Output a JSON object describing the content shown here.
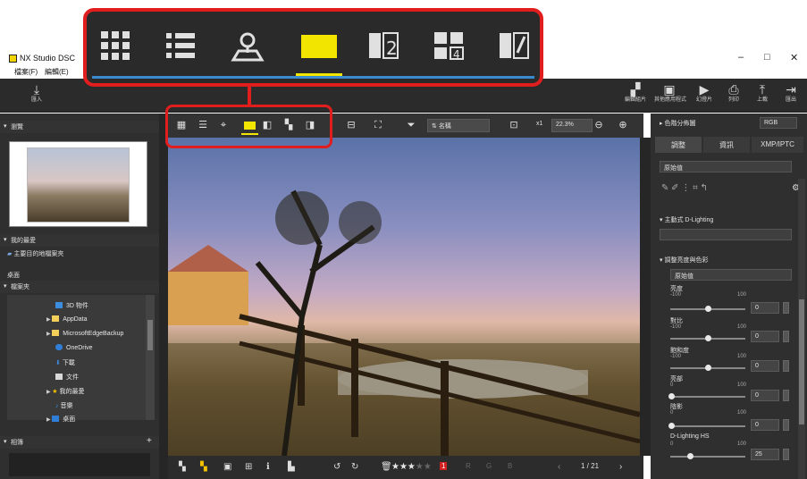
{
  "window": {
    "title": "NX Studio   DSC",
    "minimize": "–",
    "maximize": "□",
    "close": "✕"
  },
  "menu": {
    "file": "檔案(F)",
    "edit": "編輯(E)"
  },
  "toolbar": {
    "import": "匯入",
    "right_buttons": [
      "編輯組片",
      "其他應用程式",
      "幻燈片",
      "列印",
      "上載",
      "匯出"
    ]
  },
  "left_panel": {
    "browser_header": "瀏覽",
    "favorites_header": "我的最愛",
    "favorites_item": "主要目的地檔案夾",
    "favorites_item2": "桌面",
    "folders_header": "檔案夾",
    "folders": [
      "3D 物件",
      "AppData",
      "MicrosoftEdgeBackup",
      "OneDrive",
      "下載",
      "文件",
      "我的最愛",
      "音樂",
      "桌面"
    ],
    "albums_header": "相簿",
    "albums_add": "+"
  },
  "view_toolbar": {
    "sort_label": "名稱",
    "zoom_level": "22.3%",
    "fit_label": "x1"
  },
  "bottom_bar": {
    "page": "1 / 21",
    "rating_stars": 3,
    "label_r": "R",
    "label_g": "G",
    "label_b": "B"
  },
  "right_panel": {
    "histogram_label": "色階分佈圖",
    "histogram_mode": "RGB",
    "tabs": [
      "調整",
      "資訊",
      "XMP/IPTC"
    ],
    "preset_value": "原始值",
    "active_dlighting": "主動式 D-Lighting",
    "brightness_section": "調整亮度與色彩",
    "section_preset": "原始值",
    "sliders": [
      {
        "label": "亮度",
        "min": "-100",
        "max": "100",
        "value": "0"
      },
      {
        "label": "對比",
        "min": "-100",
        "max": "100",
        "value": "0"
      },
      {
        "label": "飽和度",
        "min": "-100",
        "max": "100",
        "value": "0"
      },
      {
        "label": "亮部",
        "min": "0",
        "max": "100",
        "value": "0"
      },
      {
        "label": "陰影",
        "min": "0",
        "max": "100",
        "value": "0"
      },
      {
        "label": "D-Lighting HS",
        "min": "0",
        "max": "100",
        "value": "25"
      }
    ]
  },
  "callout": {
    "accent_color": "#e11e1e",
    "selected_color": "#f2e600"
  }
}
